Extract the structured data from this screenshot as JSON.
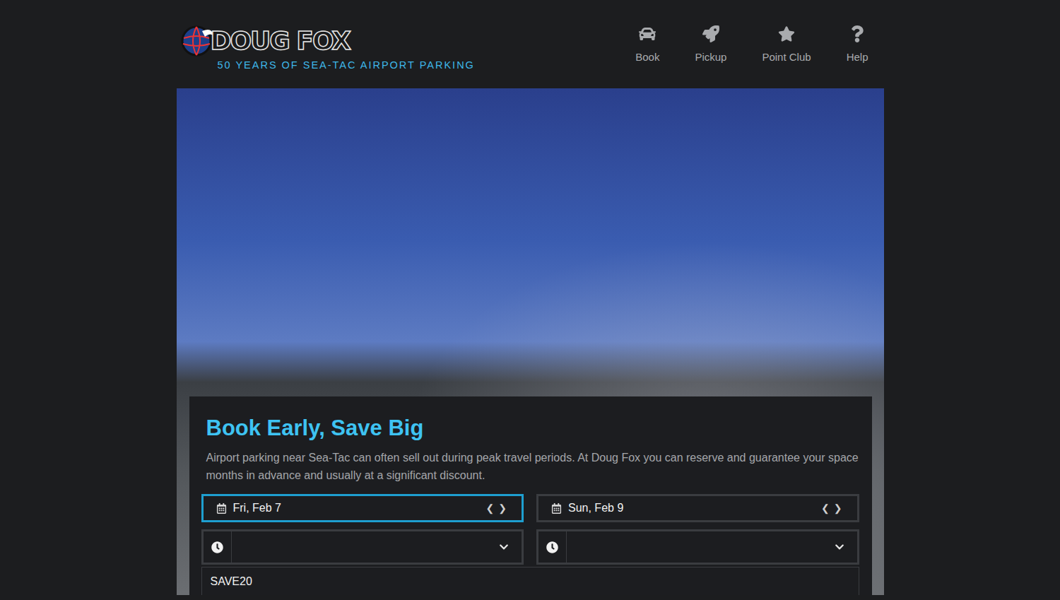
{
  "header": {
    "logo": "DOUG FOX",
    "tagline": "50 YEARS OF SEA-TAC AIRPORT PARKING"
  },
  "nav": [
    {
      "label": "Book"
    },
    {
      "label": "Pickup"
    },
    {
      "label": "Point Club"
    },
    {
      "label": "Help"
    }
  ],
  "booking": {
    "title": "Book Early, Save Big",
    "description": "Airport parking near Sea-Tac can often sell out during peak travel periods. At Doug Fox you can reserve and guarantee your space months in advance and usually at a significant discount.",
    "dates": [
      {
        "label": "Fri, Feb 7",
        "focused": true,
        "prev": "❮",
        "next": "❯"
      },
      {
        "label": "Sun, Feb 9",
        "focused": false,
        "prev": "❮",
        "next": "❯"
      }
    ],
    "times": [
      {
        "value": ""
      },
      {
        "value": ""
      }
    ],
    "promo": {
      "value": "SAVE20"
    }
  }
}
